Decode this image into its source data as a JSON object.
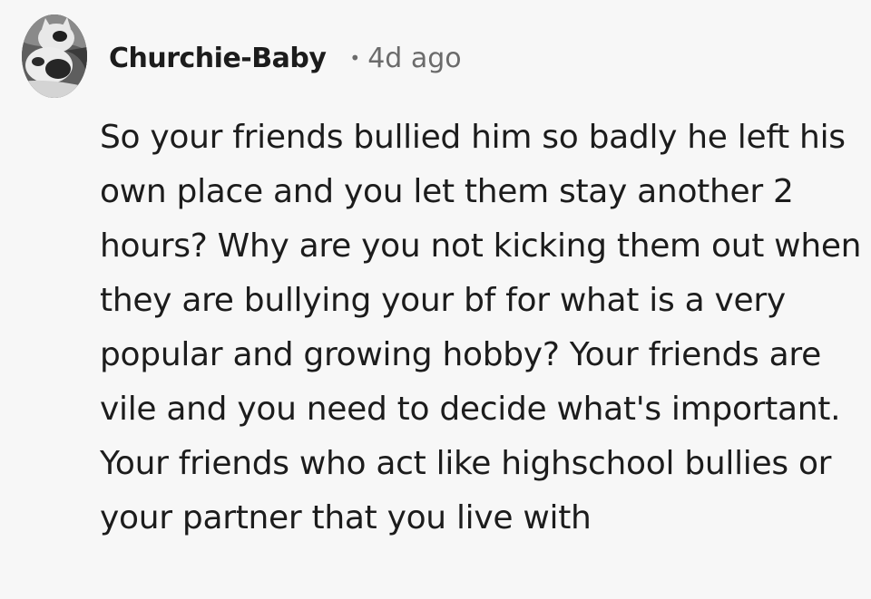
{
  "comment": {
    "username": "Churchie-Baby",
    "separator": "•",
    "timestamp": "4d ago",
    "avatar_icon": "cat-avatar-icon",
    "body": "So your friends bullied him so badly he left his own place and you let them stay another 2 hours? Why are you not kicking them out when they are bullying your bf for what is a very popular and growing hobby? Your friends are vile and you need to decide what's important. Your friends who act like highschool bullies or your partner that you live with"
  },
  "colors": {
    "background": "#f7f7f7",
    "text": "#1c1c1c",
    "meta": "#6b6b6b"
  }
}
